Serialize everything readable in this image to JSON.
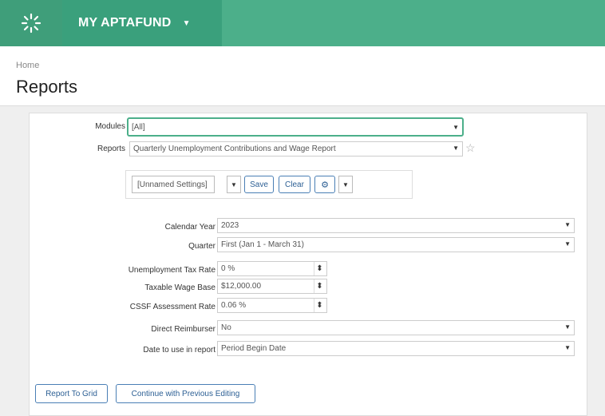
{
  "header": {
    "app_name": "MY APTAFUND",
    "app_caret": "▼"
  },
  "page": {
    "breadcrumb": "Home",
    "title": "Reports"
  },
  "selector": {
    "modules_label": "Modules",
    "modules_value": "[All]",
    "reports_label": "Reports",
    "reports_value": "Quarterly Unemployment Contributions and Wage Report"
  },
  "settings": {
    "name_value": "[Unnamed Settings]",
    "save_label": "Save",
    "clear_label": "Clear",
    "gear_glyph": "⚙"
  },
  "params": [
    {
      "label": "Calendar Year",
      "value": "2023"
    },
    {
      "label": "Quarter",
      "value": "First (Jan 1 - March 31)"
    },
    {
      "label": "Unemployment Tax Rate",
      "value": "0 %"
    },
    {
      "label": "Taxable Wage Base",
      "value": "$12,000.00"
    },
    {
      "label": "CSSF Assessment Rate",
      "value": "0.06 %"
    },
    {
      "label": "Direct Reimburser",
      "value": "No"
    },
    {
      "label": "Date to use in report",
      "value": "Period Begin Date"
    }
  ],
  "footer": {
    "report_to_grid_label": "Report To Grid",
    "continue_label": "Continue with Previous Editing"
  },
  "colors": {
    "brand": "#4caf8a",
    "button_text": "#2c5f94"
  },
  "icons": {
    "logo": "app-logo-icon",
    "star": "favorite-star-icon",
    "gear": "gear-icon"
  }
}
